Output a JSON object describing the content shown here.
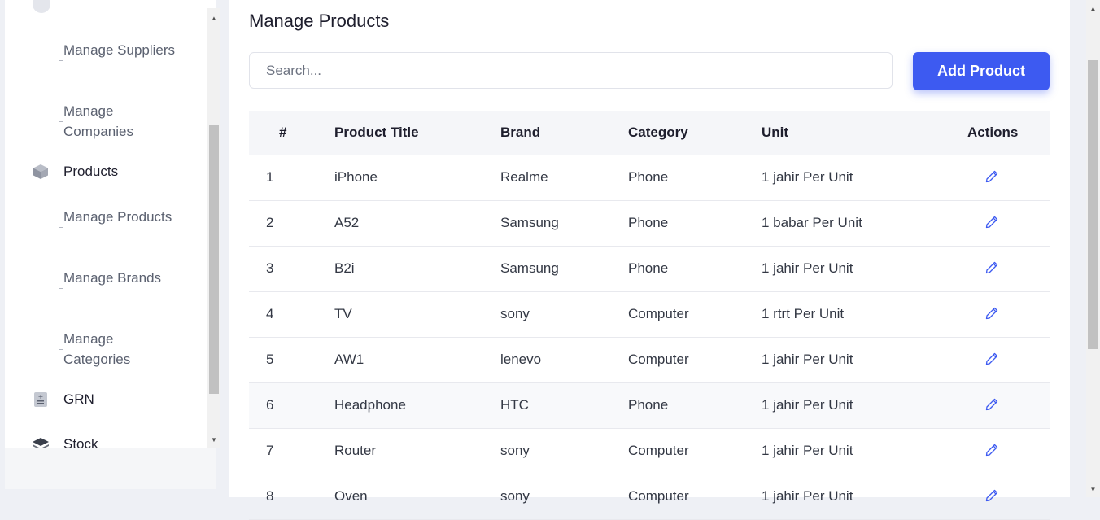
{
  "sidebar": {
    "sub_suppliers": "Manage Suppliers",
    "sub_companies": "Manage Companies",
    "products": "Products",
    "sub_products": "Manage Products",
    "sub_brands": "Manage Brands",
    "sub_categories": "Manage Categories",
    "grn": "GRN",
    "stock": "Stock"
  },
  "main": {
    "title": "Manage Products",
    "search_placeholder": "Search...",
    "add_button": "Add Product"
  },
  "table": {
    "headers": [
      "#",
      "Product Title",
      "Brand",
      "Category",
      "Unit",
      "Actions"
    ],
    "rows": [
      [
        "1",
        "iPhone",
        "Realme",
        "Phone",
        "1 jahir Per Unit"
      ],
      [
        "2",
        "A52",
        "Samsung",
        "Phone",
        "1 babar Per Unit"
      ],
      [
        "3",
        "B2i",
        "Samsung",
        "Phone",
        "1 jahir Per Unit"
      ],
      [
        "4",
        "TV",
        "sony",
        "Computer",
        "1 rtrt Per Unit"
      ],
      [
        "5",
        "AW1",
        "lenevo",
        "Computer",
        "1 jahir Per Unit"
      ],
      [
        "6",
        "Headphone",
        "HTC",
        "Phone",
        "1 jahir Per Unit"
      ],
      [
        "7",
        "Router",
        "sony",
        "Computer",
        "1 jahir Per Unit"
      ],
      [
        "8",
        "Oven",
        "sony",
        "Computer",
        "1 jahir Per Unit"
      ]
    ]
  },
  "icons": {
    "edit": "pencil-icon",
    "products": "cube-icon",
    "grn": "calculator-icon",
    "stock": "layers-icon"
  },
  "colors": {
    "accent": "#3d5af1",
    "edit_icon": "#3d5af1"
  }
}
